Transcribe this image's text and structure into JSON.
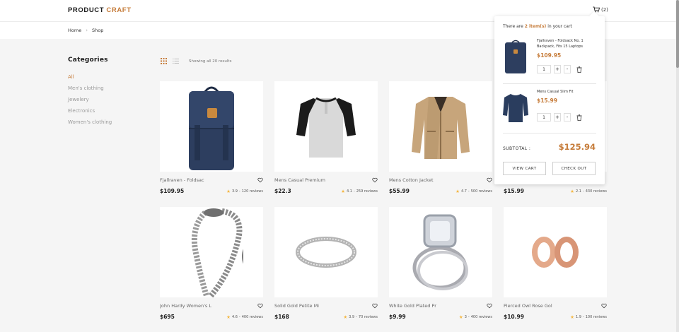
{
  "header": {
    "logo_primary": "PRODUCT",
    "logo_accent": "CRAFT",
    "cart_count": "(2)"
  },
  "breadcrumb": {
    "home": "Home",
    "current": "Shop"
  },
  "sidebar": {
    "title": "Categories",
    "items": [
      {
        "label": "All",
        "active": true
      },
      {
        "label": "Men's clothing",
        "active": false
      },
      {
        "label": "Jewelery",
        "active": false
      },
      {
        "label": "Electronics",
        "active": false
      },
      {
        "label": "Women's clothing",
        "active": false
      }
    ]
  },
  "toolbar": {
    "results_text": "Showing all 20 results"
  },
  "products": [
    {
      "name": "Fjallraven - Foldsac",
      "price": "$109.95",
      "rating": "3.9",
      "reviews": "120 reviews",
      "image": "backpack"
    },
    {
      "name": "Mens Casual Premium",
      "price": "$22.3",
      "rating": "4.1",
      "reviews": "259 reviews",
      "image": "raglan-shirt"
    },
    {
      "name": "Mens Cotton Jacket",
      "price": "$55.99",
      "rating": "4.7",
      "reviews": "500 reviews",
      "image": "jacket"
    },
    {
      "name": "",
      "price": "$15.99",
      "rating": "2.1",
      "reviews": "430 reviews",
      "image": "hidden"
    },
    {
      "name": "John Hardy Women's L",
      "price": "$695",
      "rating": "4.6",
      "reviews": "400 reviews",
      "image": "bracelet"
    },
    {
      "name": "Solid Gold Petite Mi",
      "price": "$168",
      "rating": "3.9",
      "reviews": "70 reviews",
      "image": "ring"
    },
    {
      "name": "White Gold Plated Pr",
      "price": "$9.99",
      "rating": "3",
      "reviews": "400 reviews",
      "image": "diamond-ring"
    },
    {
      "name": "Pierced Owl Rose Gol",
      "price": "$10.99",
      "rating": "1.9",
      "reviews": "100 reviews",
      "image": "plugs"
    }
  ],
  "cart": {
    "message_prefix": "There are",
    "message_count": "2 item(s)",
    "message_suffix": "in your cart",
    "items": [
      {
        "title": "Fjallraven - Foldsack No. 1 Backpack, Fits 15 Laptops",
        "price": "$109.95",
        "qty": "1"
      },
      {
        "title": "Mens Casual Slim Fit",
        "price": "$15.99",
        "qty": "1"
      }
    ],
    "plus_label": "+",
    "minus_label": "-",
    "subtotal_label": "SUBTOTAL :",
    "subtotal_value": "$125.94",
    "view_cart_label": "VIEW CART",
    "checkout_label": "CHECK OUT"
  },
  "colors": {
    "accent": "#c67c3a",
    "star": "#f4b63f",
    "navy": "#2a3d5e",
    "tan": "#c7a57b"
  }
}
